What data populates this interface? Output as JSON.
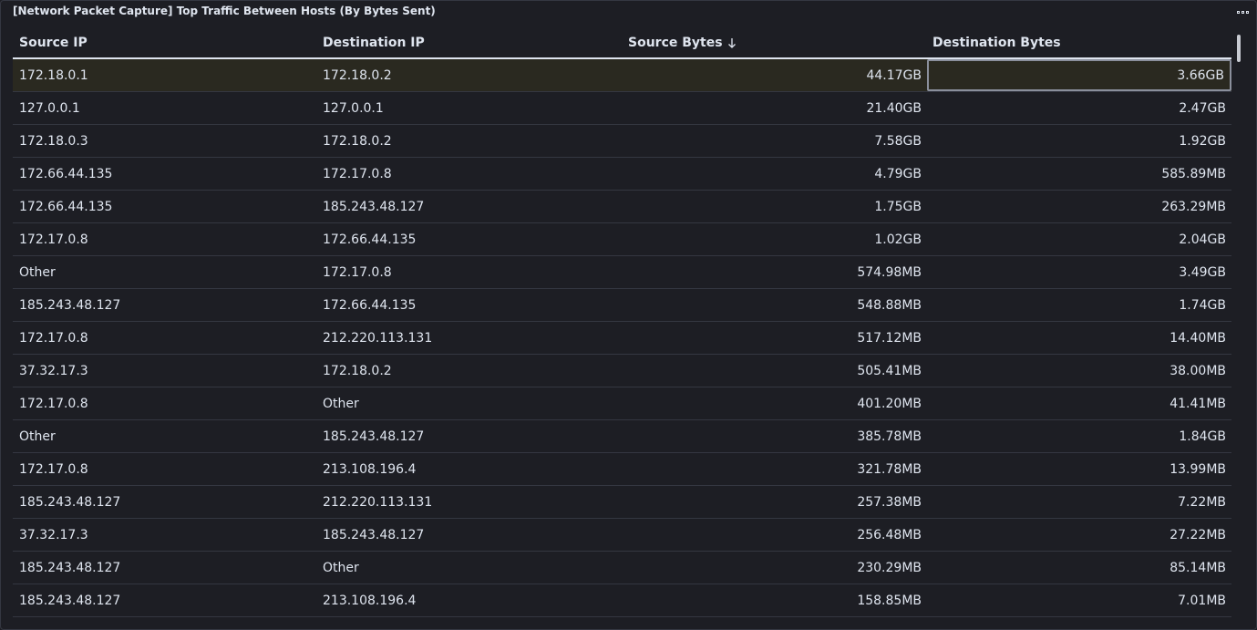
{
  "panel": {
    "title": "[Network Packet Capture] Top Traffic Between Hosts (By Bytes Sent)"
  },
  "table": {
    "columns": [
      "Source IP",
      "Destination IP",
      "Source Bytes",
      "Destination Bytes"
    ],
    "sorted_column": "Source Bytes",
    "sort_direction": "descending",
    "rows": [
      [
        "172.18.0.1",
        "172.18.0.2",
        "44.17GB",
        "3.66GB"
      ],
      [
        "127.0.0.1",
        "127.0.0.1",
        "21.40GB",
        "2.47GB"
      ],
      [
        "172.18.0.3",
        "172.18.0.2",
        "7.58GB",
        "1.92GB"
      ],
      [
        "172.66.44.135",
        "172.17.0.8",
        "4.79GB",
        "585.89MB"
      ],
      [
        "172.66.44.135",
        "185.243.48.127",
        "1.75GB",
        "263.29MB"
      ],
      [
        "172.17.0.8",
        "172.66.44.135",
        "1.02GB",
        "2.04GB"
      ],
      [
        "Other",
        "172.17.0.8",
        "574.98MB",
        "3.49GB"
      ],
      [
        "185.243.48.127",
        "172.66.44.135",
        "548.88MB",
        "1.74GB"
      ],
      [
        "172.17.0.8",
        "212.220.113.131",
        "517.12MB",
        "14.40MB"
      ],
      [
        "37.32.17.3",
        "172.18.0.2",
        "505.41MB",
        "38.00MB"
      ],
      [
        "172.17.0.8",
        "Other",
        "401.20MB",
        "41.41MB"
      ],
      [
        "Other",
        "185.243.48.127",
        "385.78MB",
        "1.84GB"
      ],
      [
        "172.17.0.8",
        "213.108.196.4",
        "321.78MB",
        "13.99MB"
      ],
      [
        "185.243.48.127",
        "212.220.113.131",
        "257.38MB",
        "7.22MB"
      ],
      [
        "37.32.17.3",
        "185.243.48.127",
        "256.48MB",
        "27.22MB"
      ],
      [
        "185.243.48.127",
        "Other",
        "230.29MB",
        "85.14MB"
      ],
      [
        "185.243.48.127",
        "213.108.196.4",
        "158.85MB",
        "7.01MB"
      ]
    ]
  },
  "icons": {
    "options": "panel-options-icon",
    "sort": "arrow-down-icon"
  },
  "colors": {
    "background": "#1d1e24",
    "text": "#dfe5ef",
    "row_border": "#343741",
    "highlight_row": "#2a2920",
    "focus_border": "#8a8f9c"
  }
}
